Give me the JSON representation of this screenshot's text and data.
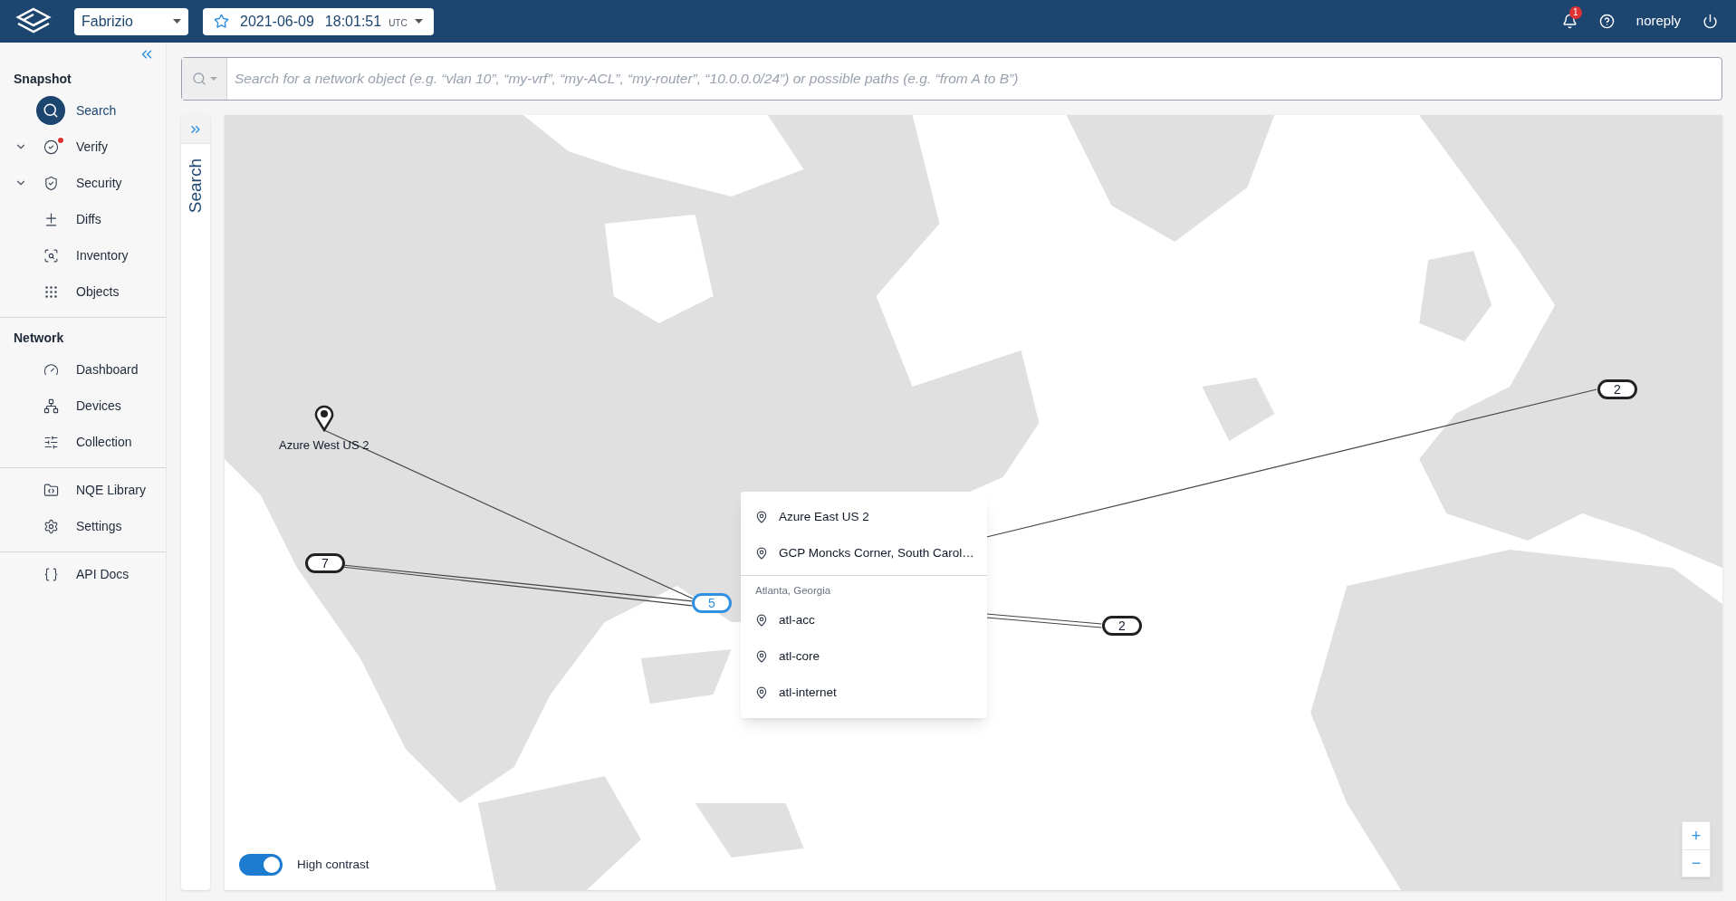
{
  "header": {
    "org_select": "Fabrizio",
    "snapshot": {
      "date": "2021-06-09",
      "time": "18:01:51",
      "zone": "UTC"
    },
    "notification_count": "1",
    "user": "noreply"
  },
  "sidebar": {
    "sections": [
      {
        "title": "Snapshot",
        "items": [
          {
            "label": "Search",
            "selected": true,
            "expandable": false,
            "alert": false
          },
          {
            "label": "Verify",
            "selected": false,
            "expandable": true,
            "alert": true
          },
          {
            "label": "Security",
            "selected": false,
            "expandable": true,
            "alert": false
          },
          {
            "label": "Diffs",
            "selected": false,
            "expandable": false,
            "alert": false
          },
          {
            "label": "Inventory",
            "selected": false,
            "expandable": false,
            "alert": false
          },
          {
            "label": "Objects",
            "selected": false,
            "expandable": false,
            "alert": false
          }
        ]
      },
      {
        "title": "Network",
        "items": [
          {
            "label": "Dashboard",
            "selected": false,
            "expandable": false,
            "alert": false
          },
          {
            "label": "Devices",
            "selected": false,
            "expandable": false,
            "alert": false
          },
          {
            "label": "Collection",
            "selected": false,
            "expandable": false,
            "alert": false
          }
        ]
      },
      {
        "items": [
          {
            "label": "NQE Library",
            "selected": false,
            "expandable": false,
            "alert": false
          },
          {
            "label": "Settings",
            "selected": false,
            "expandable": false,
            "alert": false
          }
        ]
      },
      {
        "items": [
          {
            "label": "API Docs",
            "selected": false,
            "expandable": false,
            "alert": false
          }
        ]
      }
    ]
  },
  "search": {
    "placeholder": "Search for a network object (e.g. “vlan 10”, “my-vrf”, “my-ACL”, “my-router”, “10.0.0.0/24”) or possible paths (e.g. “from A to B”)"
  },
  "side_tab": {
    "label": "Search"
  },
  "map": {
    "markers": [
      {
        "kind": "pin",
        "label": "Azure West US 2"
      },
      {
        "kind": "cluster",
        "label": "7",
        "selected": false
      },
      {
        "kind": "cluster",
        "label": "5",
        "selected": true
      },
      {
        "kind": "cluster",
        "label": "2",
        "selected": false
      },
      {
        "kind": "cluster",
        "label": "2",
        "selected": false
      }
    ],
    "popup": {
      "items": [
        "Azure East US 2",
        "GCP Moncks Corner, South Carol…"
      ],
      "group": "Atlanta, Georgia",
      "group_items": [
        "atl-acc",
        "atl-core",
        "atl-internet"
      ]
    },
    "high_contrast": {
      "label": "High contrast",
      "on": true
    },
    "zoom_buttons": [
      "+",
      "−"
    ]
  }
}
